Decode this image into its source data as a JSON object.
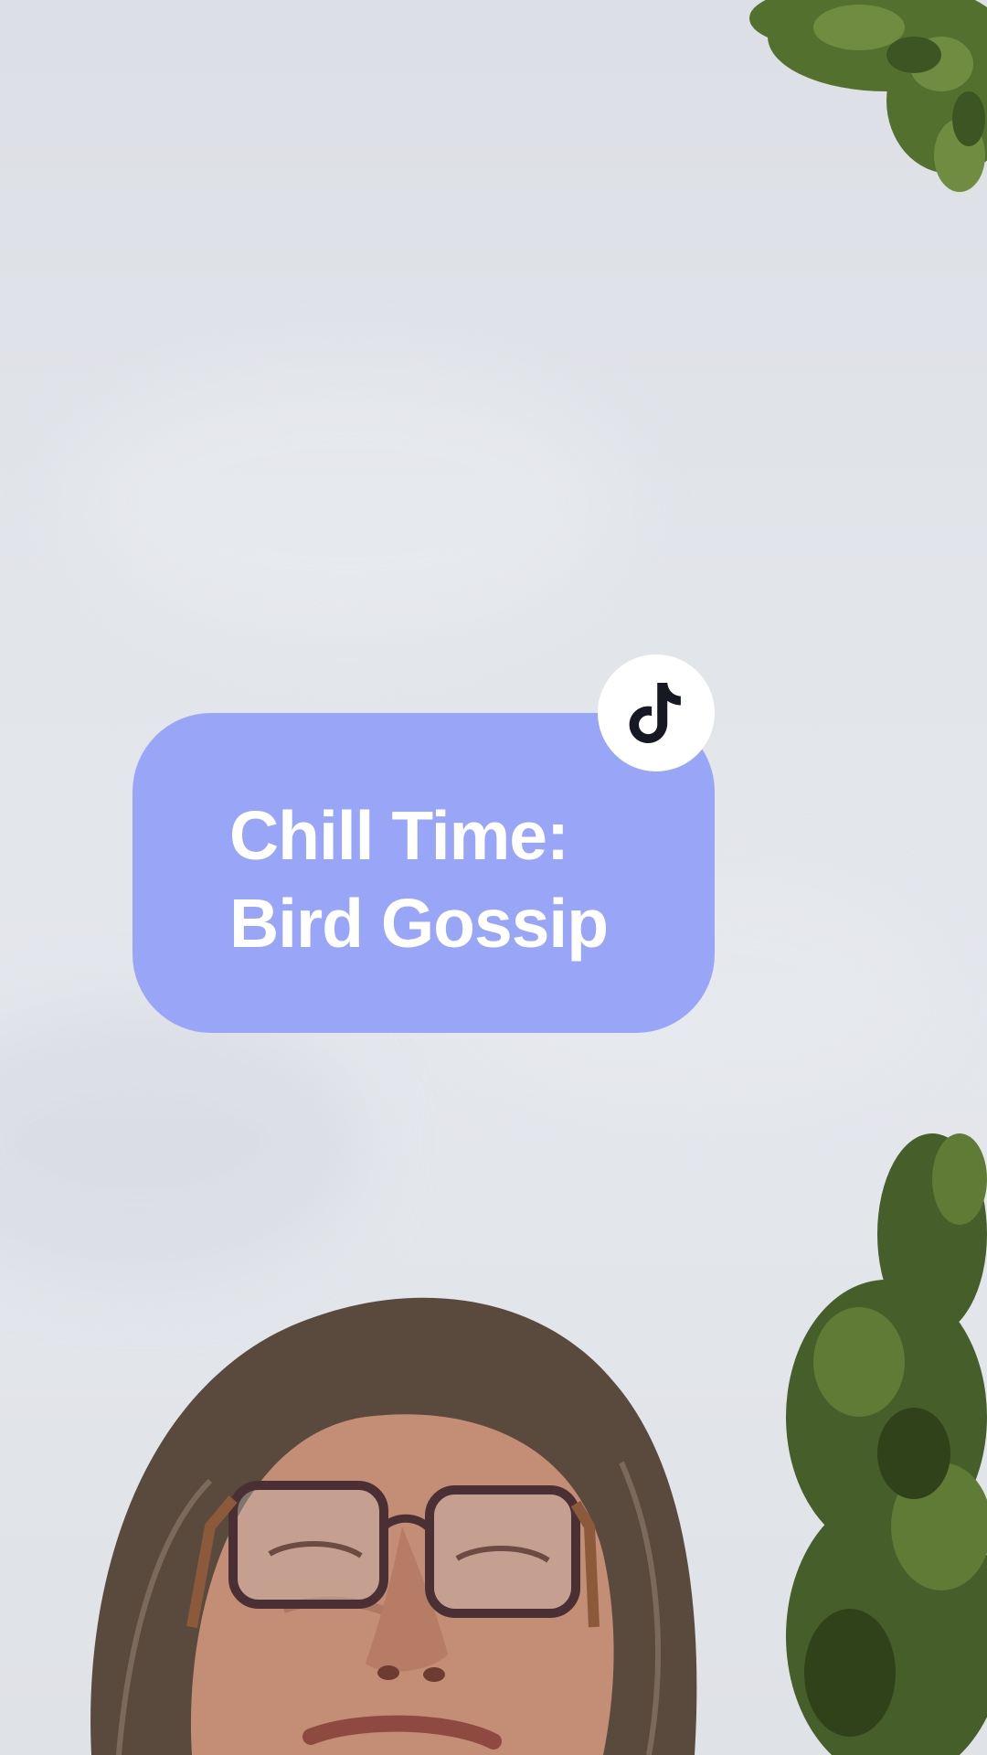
{
  "overlay": {
    "title_line1": "Chill Time:",
    "title_line2": "Bird Gossip"
  },
  "badge": {
    "icon": "tiktok-logo-icon"
  },
  "colors": {
    "card_background": "#99a6f7",
    "title_text": "#ffffff",
    "badge_background": "#ffffff",
    "logo": "#161823",
    "sky": "#e2e5ea",
    "foliage": "#4f6b32"
  }
}
